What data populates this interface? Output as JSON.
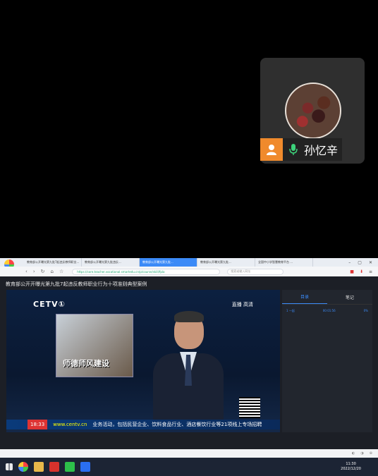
{
  "meeting": {
    "participant_name": "孙忆辛"
  },
  "browser": {
    "tabs": [
      {
        "label": "教育部公开曝光第九批7起违反教师职业..."
      },
      {
        "label": "教育部公开曝光第九批违反..."
      },
      {
        "label": "教育部公开曝光第九批..."
      },
      {
        "label": "教育部公开曝光第九批..."
      },
      {
        "label": "全国中小学智慧教育平台 ..."
      }
    ],
    "url": "https://core.teacher.vocational.smartedu.cn/p/course/skill/fpla",
    "search_placeholder": "搜索或输入网址"
  },
  "page": {
    "title": "教育部公开开曝光第九批7起违反教师职业行为十项准则典型案例",
    "video": {
      "channel": "CETV①",
      "live_label": "直播 高清",
      "caption": "师德师风建设",
      "time": "18:33",
      "site": "www.centv.cn",
      "ticker": "业务活动，包括民营企业、饮料食品行业、酒店餐饮行业等21项线上专场招聘"
    },
    "side_tabs": [
      "目录",
      "笔记"
    ],
    "side_item": {
      "label": "1 一起",
      "time": "00:01:56",
      "progress": "0%"
    }
  },
  "taskbar": {
    "time": "11:30",
    "date": "2022/12/20"
  }
}
